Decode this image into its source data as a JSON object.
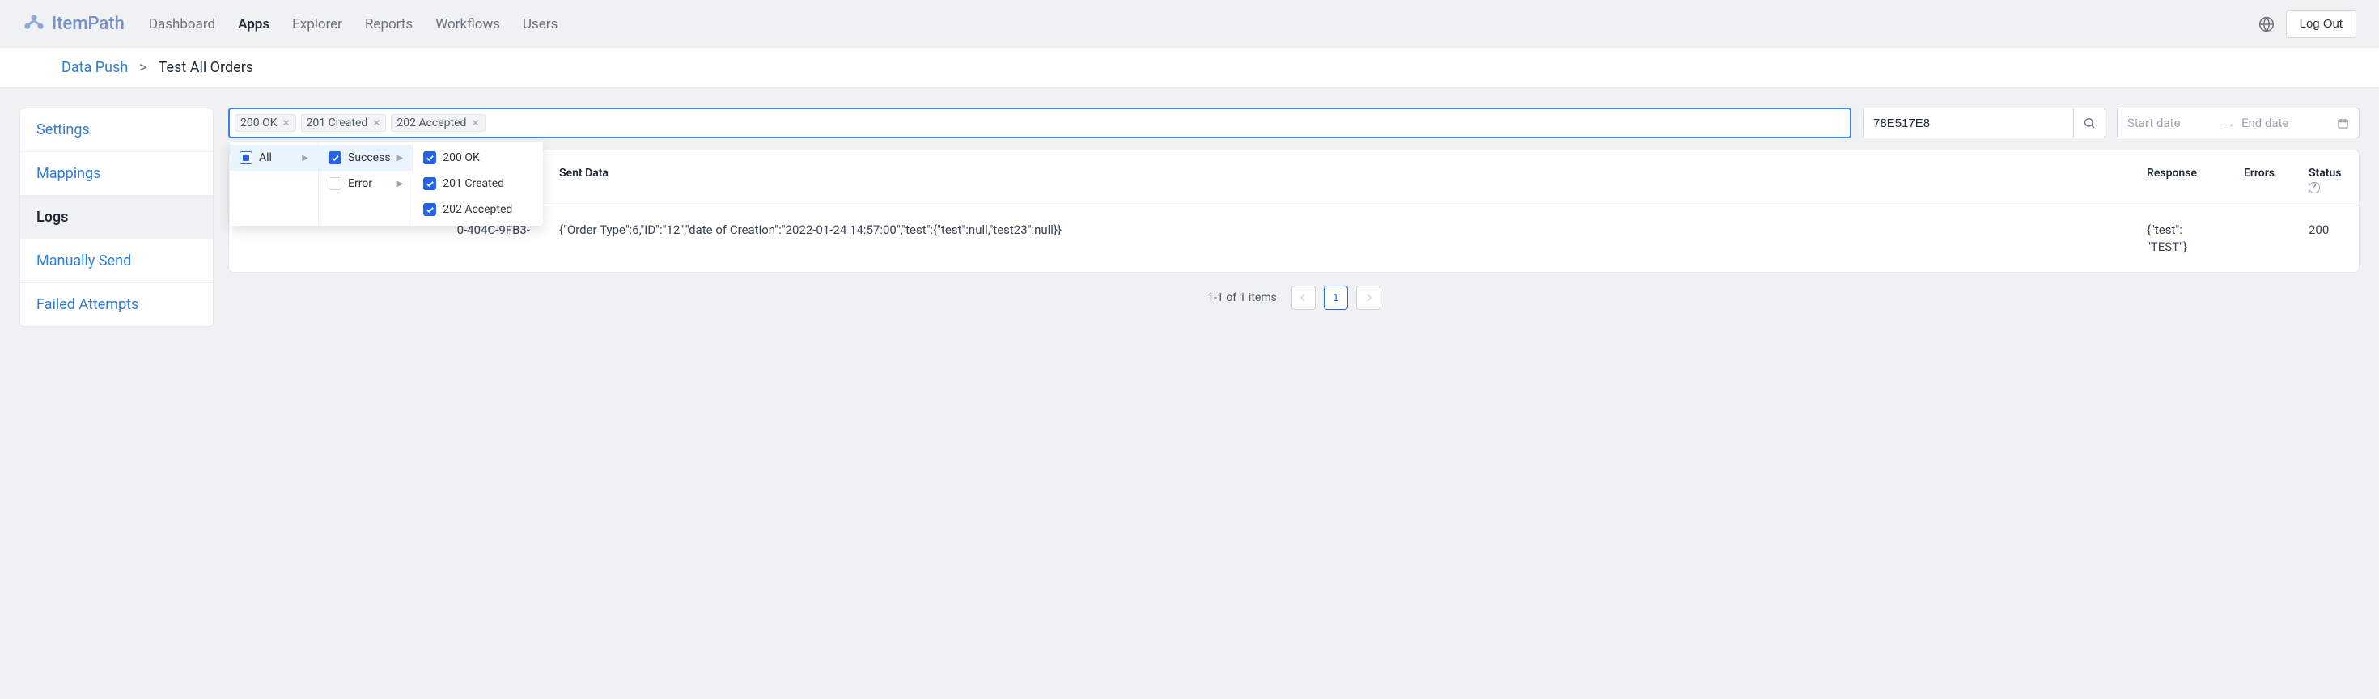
{
  "brand": "ItemPath",
  "nav": [
    {
      "label": "Dashboard",
      "active": false
    },
    {
      "label": "Apps",
      "active": true
    },
    {
      "label": "Explorer",
      "active": false
    },
    {
      "label": "Reports",
      "active": false
    },
    {
      "label": "Workflows",
      "active": false
    },
    {
      "label": "Users",
      "active": false
    }
  ],
  "logout": "Log Out",
  "breadcrumb": {
    "link": "Data Push",
    "sep": ">",
    "current": "Test All Orders"
  },
  "sidebar": [
    {
      "label": "Settings",
      "active": false
    },
    {
      "label": "Mappings",
      "active": false
    },
    {
      "label": "Logs",
      "active": true
    },
    {
      "label": "Manually Send",
      "active": false
    },
    {
      "label": "Failed Attempts",
      "active": false
    }
  ],
  "filter_tags": [
    "200 OK",
    "201 Created",
    "202 Accepted"
  ],
  "cascade": {
    "col1": [
      {
        "label": "All",
        "state": "indeterminate",
        "highlighted": true,
        "expand": true
      }
    ],
    "col2": [
      {
        "label": "Success",
        "state": "checked",
        "highlighted": true,
        "expand": true
      },
      {
        "label": "Error",
        "state": "unchecked",
        "highlighted": false,
        "expand": true
      }
    ],
    "col3": [
      {
        "label": "200 OK",
        "state": "checked"
      },
      {
        "label": "201 Created",
        "state": "checked"
      },
      {
        "label": "202 Accepted",
        "state": "checked"
      }
    ]
  },
  "search_value": "78E517E8",
  "date": {
    "start_placeholder": "Start date",
    "end_placeholder": "End date"
  },
  "table": {
    "headers": [
      "",
      "Sent Data",
      "Response",
      "Errors",
      "Status"
    ],
    "rows": [
      {
        "id_frag": "0-404C-9FB3-",
        "sent": "{\"Order Type\":6,\"ID\":\"12\",\"date of Creation\":\"2022-01-24 14:57:00\",\"test\":{\"test\":null,\"test23\":null}}",
        "response": "{\"test\": \"TEST\"}",
        "errors": "",
        "status": "200"
      }
    ]
  },
  "pagination": {
    "info": "1-1 of 1 items",
    "current": "1"
  }
}
